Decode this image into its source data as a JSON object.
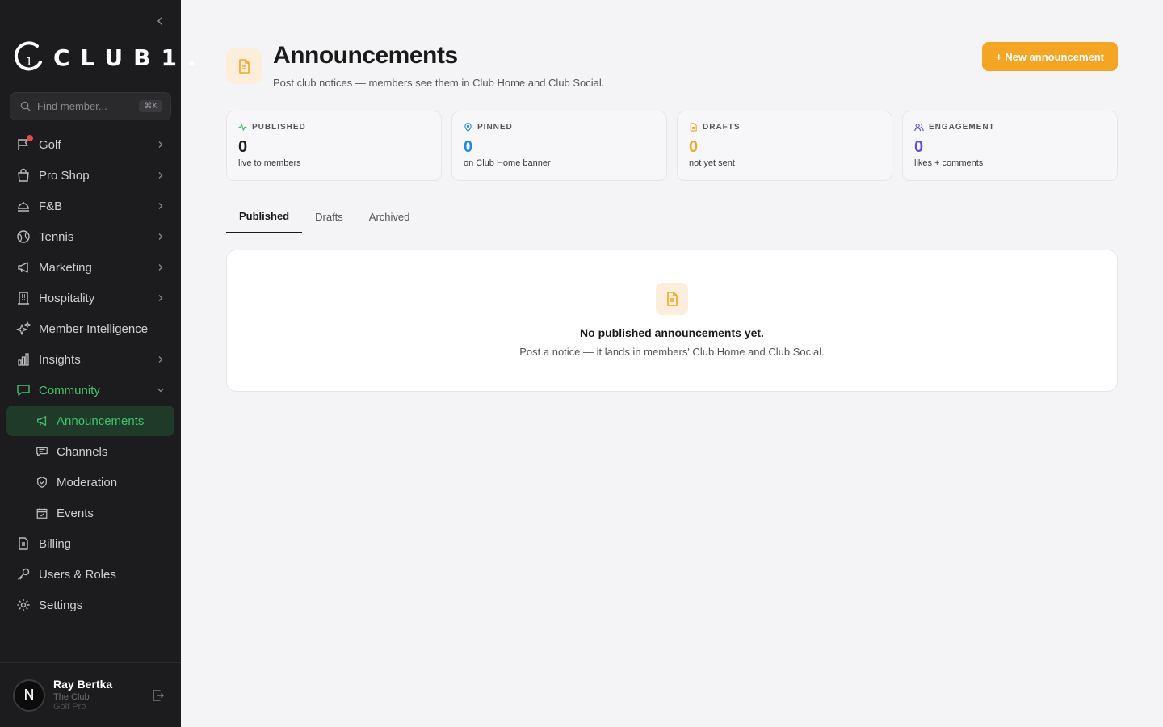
{
  "sidebar": {
    "logo_text": "CLUB1.",
    "logo_mark": "1",
    "search": {
      "placeholder": "Find member...",
      "shortcut": "⌘K"
    },
    "items": [
      {
        "label": "Golf",
        "icon": "flag-icon",
        "has_children": true
      },
      {
        "label": "Pro Shop",
        "icon": "shopping-bag-icon",
        "has_children": true
      },
      {
        "label": "F&B",
        "icon": "food-tray-icon",
        "has_children": true
      },
      {
        "label": "Tennis",
        "icon": "tennis-ball-icon",
        "has_children": true
      },
      {
        "label": "Marketing",
        "icon": "megaphone-icon",
        "has_children": true
      },
      {
        "label": "Hospitality",
        "icon": "building-icon",
        "has_children": true
      },
      {
        "label": "Member Intelligence",
        "icon": "sparkles-icon",
        "has_children": false
      },
      {
        "label": "Insights",
        "icon": "bar-chart-icon",
        "has_children": true
      },
      {
        "label": "Community",
        "icon": "chat-bubble-icon",
        "has_children": true,
        "expanded": true
      }
    ],
    "community_children": [
      {
        "label": "Announcements",
        "icon": "megaphone-icon",
        "active": true
      },
      {
        "label": "Channels",
        "icon": "chat-bubble-icon"
      },
      {
        "label": "Moderation",
        "icon": "shield-icon"
      },
      {
        "label": "Events",
        "icon": "calendar-icon"
      }
    ],
    "bottom_items": [
      {
        "label": "Billing",
        "icon": "document-icon"
      },
      {
        "label": "Users & Roles",
        "icon": "key-icon"
      },
      {
        "label": "Settings",
        "icon": "gear-icon"
      }
    ],
    "user": {
      "initial": "N",
      "name": "Ray Bertka",
      "club": "The Club",
      "role": "Golf Pro"
    }
  },
  "header": {
    "title": "Announcements",
    "subtitle": "Post club notices — members see them in Club Home and Club Social.",
    "new_button": "+ New announcement"
  },
  "stats": [
    {
      "label": "PUBLISHED",
      "value": "0",
      "desc": "live to members",
      "color": "#1a1a1a",
      "icon": "activity-icon",
      "icon_color": "#3ec46d"
    },
    {
      "label": "PINNED",
      "value": "0",
      "desc": "on Club Home banner",
      "color": "#1e88e5",
      "icon": "pin-icon",
      "icon_color": "#1e88e5"
    },
    {
      "label": "DRAFTS",
      "value": "0",
      "desc": "not yet sent",
      "color": "#f5a524",
      "icon": "document-icon",
      "icon_color": "#f5a524"
    },
    {
      "label": "ENGAGEMENT",
      "value": "0",
      "desc": "likes + comments",
      "color": "#5b4fe0",
      "icon": "users-icon",
      "icon_color": "#5b4fe0"
    }
  ],
  "tabs": [
    {
      "label": "Published",
      "active": true
    },
    {
      "label": "Drafts",
      "active": false
    },
    {
      "label": "Archived",
      "active": false
    }
  ],
  "empty_state": {
    "title": "No published announcements yet.",
    "description": "Post a notice — it lands in members' Club Home and Club Social."
  },
  "colors": {
    "accent": "#f5a524",
    "active_green": "#3ec46d",
    "sidebar_bg": "#1c1c1e"
  }
}
